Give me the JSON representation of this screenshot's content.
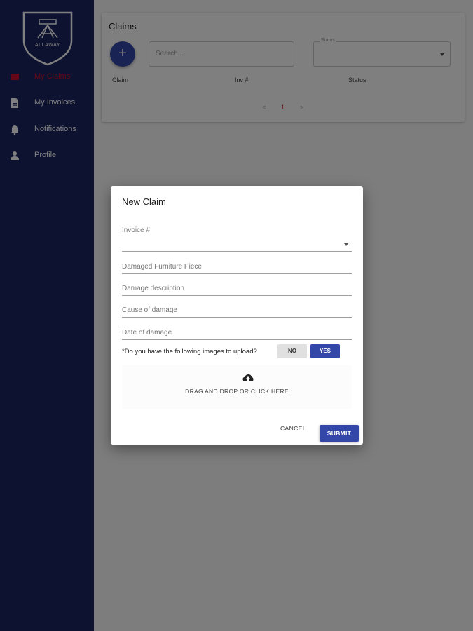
{
  "brand": {
    "logo_text": "ALLAWAY"
  },
  "sidebar": {
    "items": [
      {
        "label": "My Claims",
        "icon": "claims-icon",
        "active": true
      },
      {
        "label": "My Invoices",
        "icon": "document-icon",
        "active": false
      },
      {
        "label": "Notifications",
        "icon": "bell-icon",
        "active": false
      },
      {
        "label": "Profile",
        "icon": "person-icon",
        "active": false
      }
    ]
  },
  "claims_panel": {
    "title": "Claims",
    "add_button": "+",
    "search_placeholder": "Search...",
    "status_label": "Status",
    "columns": [
      "Claim",
      "Inv #",
      "Status"
    ],
    "pagination": {
      "prev": "<",
      "current": "1",
      "next": ">"
    }
  },
  "dialog": {
    "title": "New Claim",
    "invoice_label": "Invoice #",
    "fields": [
      "Damaged Furniture Piece",
      "Damage description",
      "Cause of damage",
      "Date of damage"
    ],
    "question": "*Do you have the following images to upload?",
    "no_label": "NO",
    "yes_label": "YES",
    "dropzone_text": "DRAG AND DROP OR CLICK HERE",
    "cancel_label": "CANCEL",
    "submit_label": "SUBMIT"
  },
  "colors": {
    "sidebar": "#1a2460",
    "accent": "#3247a8",
    "active_nav": "#c8102e"
  }
}
